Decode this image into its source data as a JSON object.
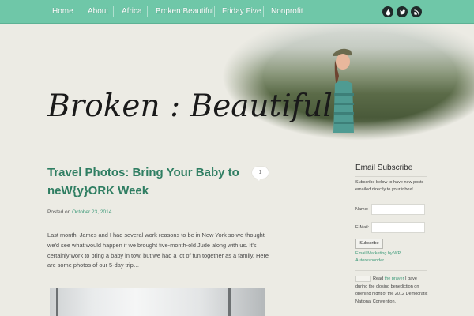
{
  "nav": {
    "items": [
      {
        "label": "Home"
      },
      {
        "label": "About"
      },
      {
        "label": "Africa"
      },
      {
        "label": "Broken:Beautiful"
      },
      {
        "label": "Friday Five"
      },
      {
        "label": "Nonprofit"
      }
    ],
    "social_icons": [
      "water-drop-icon",
      "twitter-icon",
      "rss-icon"
    ]
  },
  "header": {
    "logo_text": "Broken : Beautiful"
  },
  "post": {
    "title": "Travel Photos: Bring Your Baby to neW{y}ORK Week",
    "comment_count": "1",
    "posted_prefix": "Posted on",
    "posted_date": "October 23, 2014",
    "excerpt": "Last month, James and I had several work reasons to be in New York so we thought we'd see what would happen if we brought five-month-old Jude along with us. It's certainly work to bring a baby in tow, but we had a lot of fun together as a family. Here are some photos of our 5-day trip…"
  },
  "sidebar": {
    "subscribe": {
      "title": "Email Subscribe",
      "description": "Subscribe below to have new posts emailed directly to your inbox!",
      "name_label": "Name:",
      "email_label": "E-Mail:",
      "button_label": "Subscribe",
      "link_text": "Email Marketing by WP Autoresponder"
    },
    "prayer": {
      "prefix": "Read",
      "link": "the prayer",
      "suffix": "I gave during the closing benediction on opening night of the 2012 Democratic National Convention."
    }
  },
  "colors": {
    "nav_bg": "#6fc7a8",
    "accent": "#2f7e62",
    "link": "#3d9a79",
    "page_bg": "#ecebe4"
  }
}
